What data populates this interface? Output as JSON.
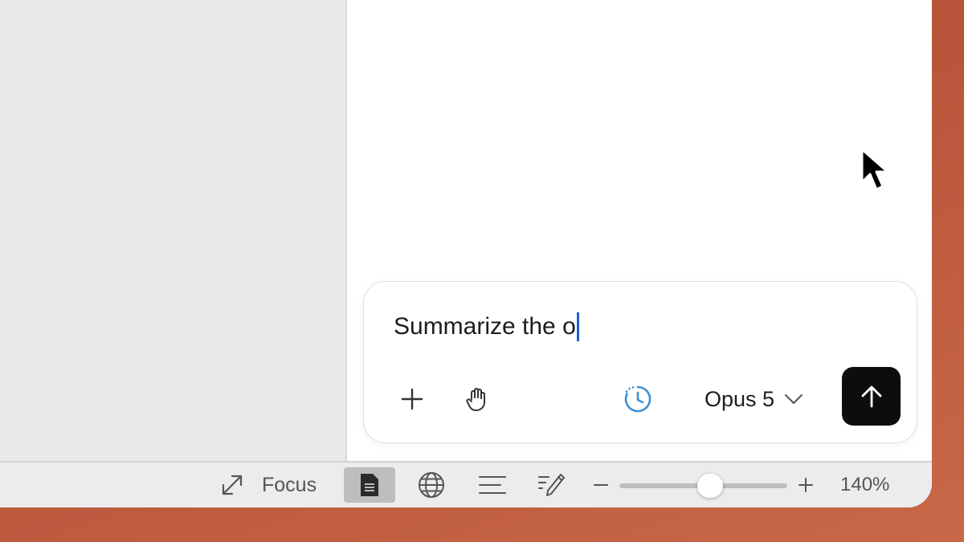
{
  "composer": {
    "text": "Summarize the o",
    "model": "Opus 5"
  },
  "icons": {
    "add": "plus-icon",
    "hand": "hand-icon",
    "history": "history-icon",
    "model_dropdown": "chevron-down-icon",
    "send": "arrow-up-icon",
    "focus": "expand-icon",
    "page_view": "document-icon",
    "web_view": "globe-icon",
    "outline_view": "lines-icon",
    "draft_view": "pencil-icon",
    "zoom_out": "minus-icon",
    "zoom_in": "plus-icon",
    "pointer": "mouse-pointer-icon"
  },
  "statusbar": {
    "focus_label": "Focus",
    "zoom_label": "140%",
    "zoom_level": 0.54
  },
  "colors": {
    "background": "#c0573b",
    "send_button": "#0d0d0d",
    "history_icon": "#3d8fd6",
    "caret": "#1a5fd1",
    "active_view": "#bdbdbd"
  }
}
